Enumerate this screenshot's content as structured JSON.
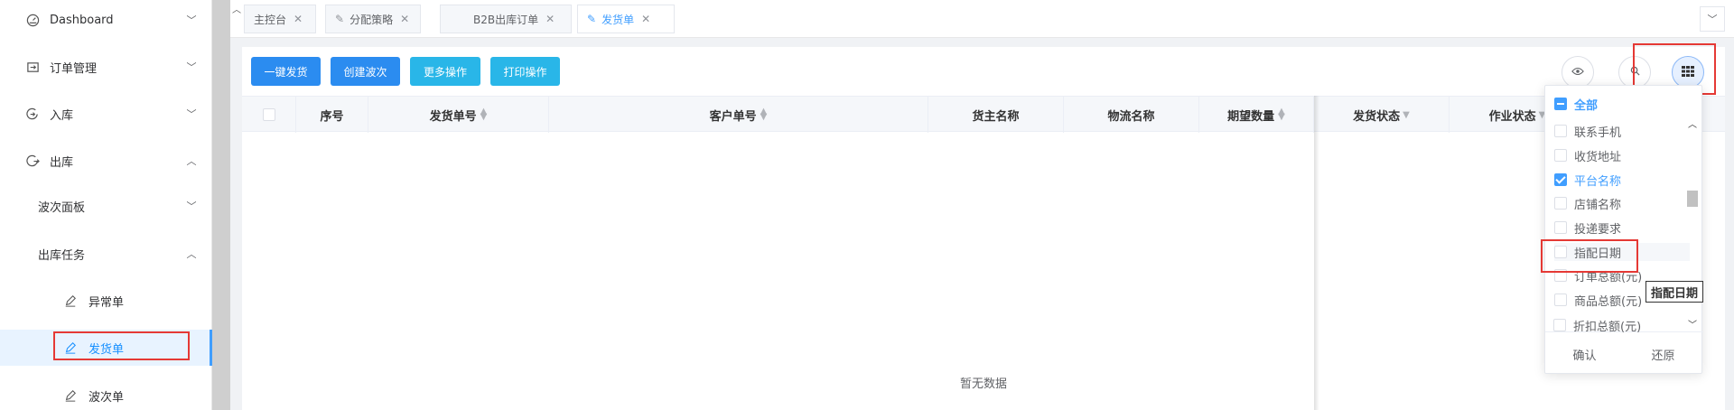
{
  "sidebar": {
    "items": [
      {
        "label": "Dashboard",
        "icon": "dashboard-icon"
      },
      {
        "label": "订单管理",
        "icon": "order-icon"
      },
      {
        "label": "入库",
        "icon": "inbound-icon"
      },
      {
        "label": "出库",
        "icon": "outbound-icon"
      },
      {
        "label": "波次面板"
      },
      {
        "label": "出库任务"
      },
      {
        "label": "异常单",
        "icon": "edit-icon"
      },
      {
        "label": "发货单",
        "icon": "edit-icon"
      },
      {
        "label": "波次单",
        "icon": "edit-icon"
      }
    ]
  },
  "tabs": [
    {
      "label": "主控台"
    },
    {
      "label": "分配策略"
    },
    {
      "label": "B2B出库订单"
    },
    {
      "label": "发货单"
    }
  ],
  "toolbar": {
    "one_click_ship": "一键发货",
    "create_wave": "创建波次",
    "more_actions": "更多操作",
    "print_actions": "打印操作"
  },
  "table": {
    "columns": [
      "序号",
      "发货单号",
      "客户单号",
      "货主名称",
      "物流名称",
      "期望数量",
      "发货状态",
      "作业状态"
    ],
    "empty_text": "暂无数据"
  },
  "column_panel": {
    "all_label": "全部",
    "items": [
      {
        "label": "联系手机",
        "checked": false
      },
      {
        "label": "收货地址",
        "checked": false
      },
      {
        "label": "平台名称",
        "checked": true
      },
      {
        "label": "店铺名称",
        "checked": false
      },
      {
        "label": "投递要求",
        "checked": false
      },
      {
        "label": "指配日期",
        "checked": false
      },
      {
        "label": "订单总额(元)",
        "checked": false
      },
      {
        "label": "商品总额(元)",
        "checked": false
      },
      {
        "label": "折扣总额(元)",
        "checked": false
      }
    ],
    "confirm": "确认",
    "reset": "还原",
    "tooltip": "指配日期"
  },
  "colors": {
    "primary": "#2b8cf0",
    "info": "#29b6e8",
    "accent": "#409eff",
    "highlight_border": "#e53935"
  }
}
